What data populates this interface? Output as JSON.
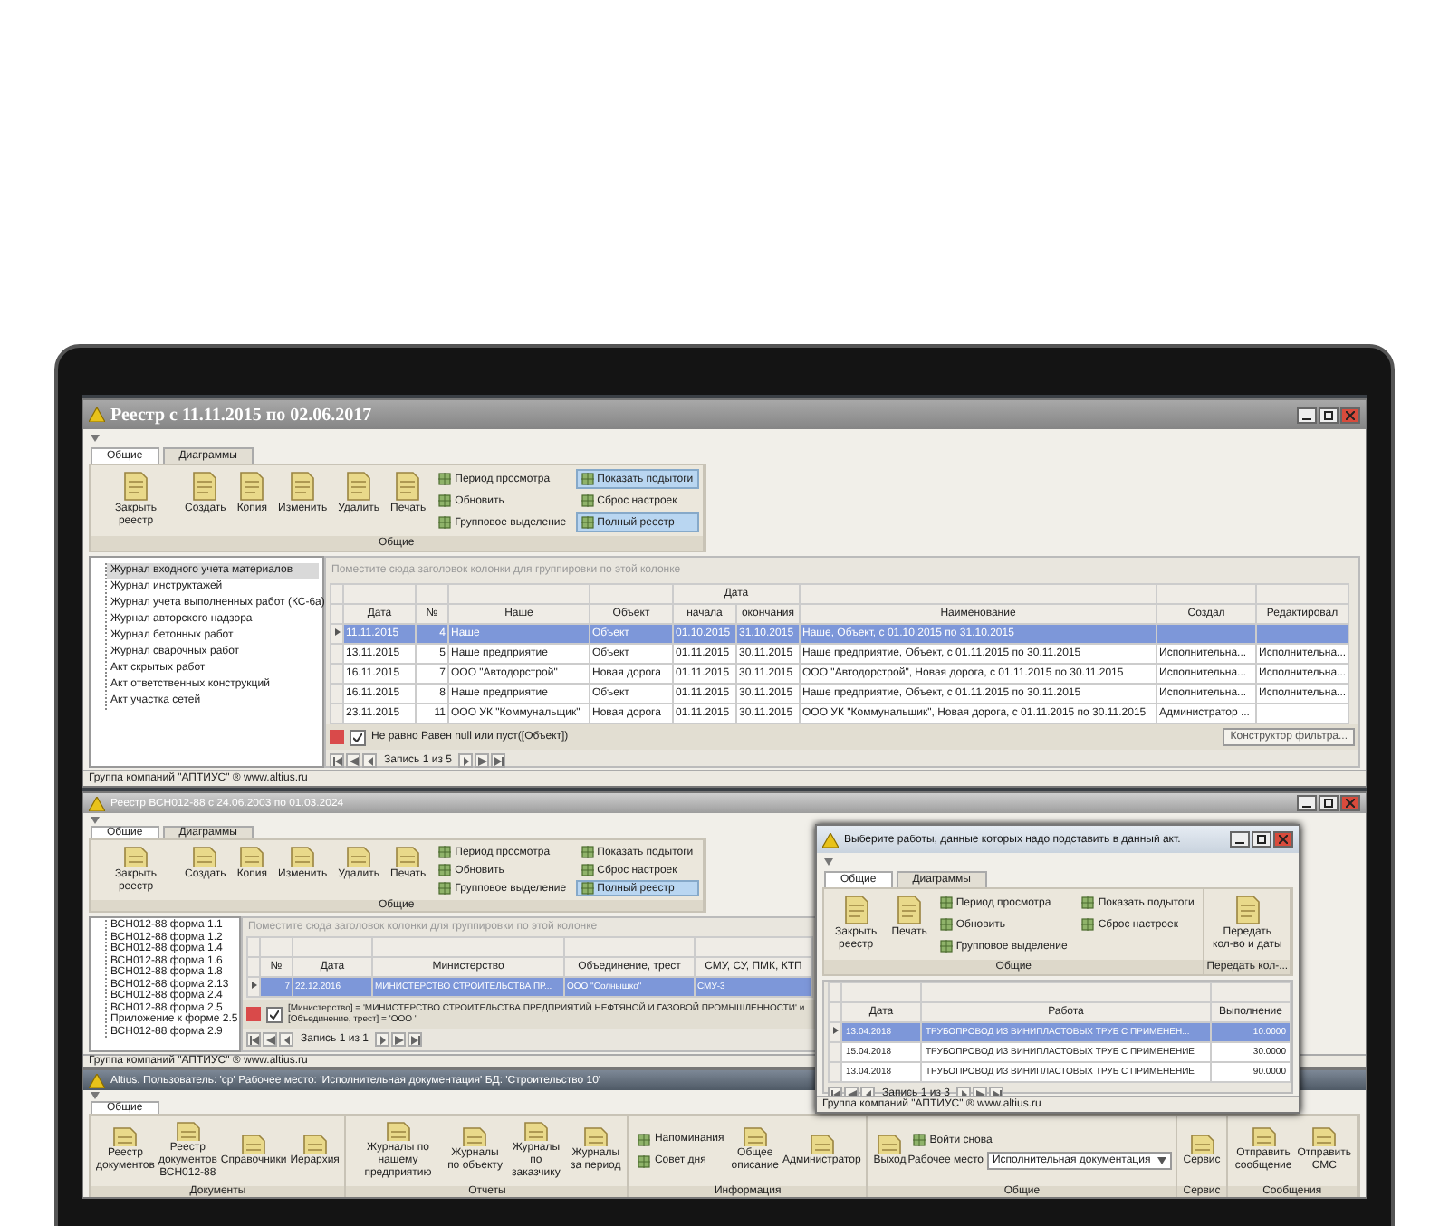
{
  "registry_window": {
    "title": "Реестр с 11.11.2015 по 02.06.2017",
    "tabs": [
      {
        "label": "Общие",
        "selected": true
      },
      {
        "label": "Диаграммы",
        "selected": false
      }
    ],
    "ribbon": [
      {
        "label": "Общие",
        "items": [
          {
            "kind": "big",
            "label": "Закрыть реестр"
          },
          {
            "kind": "big",
            "label": "Создать"
          },
          {
            "kind": "big",
            "label": "Копия"
          },
          {
            "kind": "big",
            "label": "Изменить"
          },
          {
            "kind": "big",
            "label": "Удалить"
          },
          {
            "kind": "big",
            "label": "Печать"
          },
          {
            "kind": "small",
            "buttons": [
              {
                "label": "Период просмотра",
                "selected": false
              },
              {
                "label": "Обновить",
                "selected": false
              },
              {
                "label": "Групповое выделение",
                "selected": false
              }
            ]
          },
          {
            "kind": "small",
            "buttons": [
              {
                "label": "Показать подытоги",
                "selected": true
              },
              {
                "label": "Сброс настроек",
                "selected": false
              },
              {
                "label": "Полный реестр",
                "selected": true
              }
            ]
          }
        ]
      }
    ],
    "tree": [
      {
        "label": "Журнал входного учета материалов",
        "selected": true
      },
      {
        "label": "Журнал инструктажей",
        "selected": false
      },
      {
        "label": "Журнал учета выполненных работ (КС-6а)",
        "selected": false
      },
      {
        "label": "Журнал авторского надзора",
        "selected": false
      },
      {
        "label": "Журнал бетонных работ",
        "selected": false
      },
      {
        "label": "Журнал сварочных работ",
        "selected": false
      },
      {
        "label": "Акт скрытых работ",
        "selected": false
      },
      {
        "label": "Акт ответственных конструкций",
        "selected": false
      },
      {
        "label": "Акт участка сетей",
        "selected": false
      }
    ],
    "group_hint": "Поместите сюда заголовок колонки для группировки по этой колонке",
    "table": {
      "band_label": "Дата",
      "columns": [
        "Дата",
        "№",
        "Наше",
        "Объект",
        "начала",
        "окончания",
        "Наименование",
        "Создал",
        "Редактировал"
      ],
      "rows": [
        {
          "selected": true,
          "cells": [
            "11.11.2015",
            "4",
            "Наше",
            "Объект",
            "01.10.2015",
            "31.10.2015",
            "Наше, Объект, с 01.10.2015 по 31.10.2015",
            "",
            ""
          ]
        },
        {
          "selected": false,
          "cells": [
            "13.11.2015",
            "5",
            "Наше предприятие",
            "Объект",
            "01.11.2015",
            "30.11.2015",
            "Наше предприятие, Объект, с 01.11.2015 по 30.11.2015",
            "Исполнительна...",
            "Исполнительна..."
          ]
        },
        {
          "selected": false,
          "cells": [
            "16.11.2015",
            "7",
            "ООО \"Автодорстрой\"",
            "Новая дорога",
            "01.11.2015",
            "30.11.2015",
            "ООО \"Автодорстрой\", Новая дорога, с 01.11.2015 по 30.11.2015",
            "Исполнительна...",
            "Исполнительна..."
          ]
        },
        {
          "selected": false,
          "cells": [
            "16.11.2015",
            "8",
            "Наше предприятие",
            "Объект",
            "01.11.2015",
            "30.11.2015",
            "Наше предприятие, Объект, с 01.11.2015 по 30.11.2015",
            "Исполнительна...",
            "Исполнительна..."
          ]
        },
        {
          "selected": false,
          "cells": [
            "23.11.2015",
            "11",
            "ООО УК \"Коммунальщик\"",
            "Новая дорога",
            "01.11.2015",
            "30.11.2015",
            "ООО УК \"Коммунальщик\", Новая дорога, с 01.11.2015 по 30.11.2015",
            "Администратор ...",
            ""
          ]
        }
      ]
    },
    "filter": {
      "checked": true,
      "text": "Не равно Равен null или пуст([Объект])",
      "builder": "Конструктор фильтра..."
    },
    "pager": "Запись 1 из 5",
    "status": "Группа компаний \"АПТИУС\" ® www.altius.ru"
  },
  "vsn_window": {
    "title": "Реестр ВСН012-88 с 24.06.2003 по 01.03.2024",
    "tabs": [
      {
        "label": "Общие",
        "selected": true
      },
      {
        "label": "Диаграммы",
        "selected": false
      }
    ],
    "ribbon": [
      {
        "label": "Общие",
        "items": [
          {
            "kind": "big",
            "label": "Закрыть реестр"
          },
          {
            "kind": "big",
            "label": "Создать"
          },
          {
            "kind": "big",
            "label": "Копия"
          },
          {
            "kind": "big",
            "label": "Изменить"
          },
          {
            "kind": "big",
            "label": "Удалить"
          },
          {
            "kind": "big",
            "label": "Печать"
          },
          {
            "kind": "small",
            "buttons": [
              {
                "label": "Период просмотра",
                "selected": false
              },
              {
                "label": "Обновить",
                "selected": false
              },
              {
                "label": "Групповое выделение",
                "selected": false
              }
            ]
          },
          {
            "kind": "small",
            "buttons": [
              {
                "label": "Показать подытоги",
                "selected": false
              },
              {
                "label": "Сброс настроек",
                "selected": false
              },
              {
                "label": "Полный реестр",
                "selected": true
              }
            ]
          }
        ]
      }
    ],
    "tree": [
      {
        "label": "ВСН012-88 форма 1.1",
        "selected": false
      },
      {
        "label": "ВСН012-88 форма 1.2",
        "selected": false
      },
      {
        "label": "ВСН012-88 форма 1.4",
        "selected": false
      },
      {
        "label": "ВСН012-88 форма 1.6",
        "selected": false
      },
      {
        "label": "ВСН012-88 форма 1.8",
        "selected": false
      },
      {
        "label": "ВСН012-88 форма 2.13",
        "selected": false
      },
      {
        "label": "ВСН012-88 форма 2.4",
        "selected": false
      },
      {
        "label": "ВСН012-88 форма 2.5",
        "selected": false
      },
      {
        "label": "Приложение к форме 2.5",
        "selected": false
      },
      {
        "label": "ВСН012-88 форма 2.9",
        "selected": false
      }
    ],
    "group_hint": "Поместите сюда заголовок колонки для группировки по этой колонке",
    "table": {
      "columns": [
        "№",
        "Дата",
        "Министерство",
        "Объединение, трест",
        "СМУ, СУ, ПМК, КТП"
      ],
      "rows": [
        {
          "selected": true,
          "cells": [
            "7",
            "22.12.2016",
            "МИНИСТЕРСТВО СТРОИТЕЛЬСТВА ПР...",
            "ООО \"Солнышко\"",
            "СМУ-3"
          ]
        }
      ]
    },
    "filter": {
      "checked": true,
      "text": "[Министерство] = 'МИНИСТЕРСТВО СТРОИТЕЛЬСТВА ПРЕДПРИЯТИЙ НЕФТЯНОЙ И ГАЗОВОЙ ПРОМЫШЛЕННОСТИ' и [Объединение, трест] = 'ООО '"
    },
    "pager": "Запись 1 из 1",
    "status": "Группа компаний \"АПТИУС\" ® www.altius.ru"
  },
  "dialog": {
    "title": "Выберите работы, данные которых надо подставить в данный акт.",
    "tabs": [
      {
        "label": "Общие",
        "selected": true
      },
      {
        "label": "Диаграммы",
        "selected": false
      }
    ],
    "ribbon": [
      {
        "label": "Общие",
        "items": [
          {
            "kind": "big",
            "label": "Закрыть реестр"
          },
          {
            "kind": "big",
            "label": "Печать"
          },
          {
            "kind": "small",
            "buttons": [
              {
                "label": "Период просмотра",
                "selected": false
              },
              {
                "label": "Обновить",
                "selected": false
              },
              {
                "label": "Групповое выделение",
                "selected": false
              }
            ]
          },
          {
            "kind": "small",
            "buttons": [
              {
                "label": "Показать подытоги",
                "selected": false
              },
              {
                "label": "Сброс настроек",
                "selected": false
              }
            ]
          }
        ]
      },
      {
        "label": "Передать кол-...",
        "items": [
          {
            "kind": "big",
            "label": "Передать кол-во и даты"
          }
        ]
      }
    ],
    "table": {
      "columns": [
        "Дата",
        "Работа",
        "Выполнение"
      ],
      "rows": [
        {
          "selected": true,
          "cells": [
            "13.04.2018",
            "ТРУБОПРОВОД ИЗ ВИНИПЛАСТОВЫХ ТРУБ С ПРИМЕНЕН...",
            "10.0000"
          ]
        },
        {
          "selected": false,
          "cells": [
            "15.04.2018",
            "ТРУБОПРОВОД ИЗ ВИНИПЛАСТОВЫХ ТРУБ С ПРИМЕНЕНИЕ",
            "30.0000"
          ]
        },
        {
          "selected": false,
          "cells": [
            "13.04.2018",
            "ТРУБОПРОВОД ИЗ ВИНИПЛАСТОВЫХ ТРУБ С ПРИМЕНЕНИЕ",
            "90.0000"
          ]
        }
      ]
    },
    "pager": "Запись 1 из 3",
    "status": "Группа компаний \"АПТИУС\" ® www.altius.ru"
  },
  "main_window": {
    "title": "Altius. Пользователь: 'ср' Рабочее место: 'Исполнительная документация' БД: 'Строительство 10'",
    "tabs": [
      {
        "label": "Общие",
        "selected": true
      }
    ],
    "ribbon": [
      {
        "label": "Документы",
        "items": [
          {
            "kind": "big",
            "label": "Реестр документов"
          },
          {
            "kind": "big",
            "label": "Реестр документов ВСН012-88"
          },
          {
            "kind": "big",
            "label": "Справочники"
          },
          {
            "kind": "big",
            "label": "Иерархия"
          }
        ]
      },
      {
        "label": "Отчеты",
        "items": [
          {
            "kind": "big",
            "label": "Журналы по нашему предприятию"
          },
          {
            "kind": "big",
            "label": "Журналы по объекту"
          },
          {
            "kind": "big",
            "label": "Журналы по заказчику"
          },
          {
            "kind": "big",
            "label": "Журналы за период"
          }
        ]
      },
      {
        "label": "Информация",
        "items": [
          {
            "kind": "small",
            "buttons": [
              {
                "label": "Напоминания",
                "selected": false
              },
              {
                "label": "Совет дня",
                "selected": false
              }
            ]
          },
          {
            "kind": "big",
            "label": "Общее описание"
          },
          {
            "kind": "big",
            "label": "Администратор"
          }
        ]
      },
      {
        "label": "Общие",
        "items": [
          {
            "kind": "big",
            "label": "Выход"
          },
          {
            "kind": "small",
            "buttons": [
              {
                "label": "Войти снова",
                "selected": false
              }
            ],
            "combo": {
              "label": "Рабочее место",
              "value": "Исполнительная документация"
            }
          }
        ]
      },
      {
        "label": "Сервис",
        "items": [
          {
            "kind": "big",
            "label": "Сервис"
          }
        ]
      },
      {
        "label": "Сообщения",
        "items": [
          {
            "kind": "big",
            "label": "Отправить сообщение"
          },
          {
            "kind": "big",
            "label": "Отправить СМС"
          }
        ]
      }
    ]
  }
}
